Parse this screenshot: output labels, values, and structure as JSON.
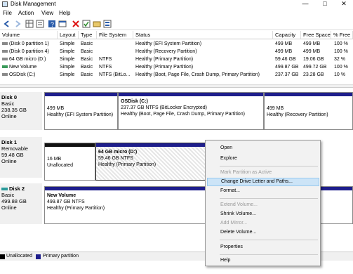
{
  "window": {
    "title": "Disk Management",
    "accent": "#1e1e8c",
    "controls": [
      "minimize",
      "maximize",
      "close"
    ]
  },
  "menu": [
    "File",
    "Action",
    "View",
    "Help"
  ],
  "toolbar": [
    "back-icon",
    "forward-icon",
    "grid-icon",
    "list-icon",
    "help-icon",
    "console-icon",
    "delete-icon",
    "check-icon",
    "open-icon",
    "properties-icon"
  ],
  "volume_list": {
    "columns": [
      "Volume",
      "Layout",
      "Type",
      "File System",
      "Status",
      "Capacity",
      "Free Space",
      "% Free"
    ],
    "rows": [
      {
        "volume": "(Disk 0 partition 1)",
        "layout": "Simple",
        "type": "Basic",
        "fs": "",
        "status": "Healthy (EFI System Partition)",
        "capacity": "499 MB",
        "free": "499 MB",
        "pct": "100 %",
        "icon": "gray"
      },
      {
        "volume": "(Disk 0 partition 4)",
        "layout": "Simple",
        "type": "Basic",
        "fs": "",
        "status": "Healthy (Recovery Partition)",
        "capacity": "499 MB",
        "free": "499 MB",
        "pct": "100 %",
        "icon": "gray"
      },
      {
        "volume": "64 GB micro (D:)",
        "layout": "Simple",
        "type": "Basic",
        "fs": "NTFS",
        "status": "Healthy (Primary Partition)",
        "capacity": "59.46 GB",
        "free": "19.06 GB",
        "pct": "32 %",
        "icon": "gray"
      },
      {
        "volume": "New Volume",
        "layout": "Simple",
        "type": "Basic",
        "fs": "NTFS",
        "status": "Healthy (Primary Partition)",
        "capacity": "499.87 GB",
        "free": "499.72 GB",
        "pct": "100 %",
        "icon": "green"
      },
      {
        "volume": "OSDisk (C:)",
        "layout": "Simple",
        "type": "Basic",
        "fs": "NTFS (BitLo...",
        "status": "Healthy (Boot, Page File, Crash Dump, Primary Partition)",
        "capacity": "237.37 GB",
        "free": "23.28 GB",
        "pct": "10 %",
        "icon": "gray"
      }
    ]
  },
  "disks": [
    {
      "name": "Disk 0",
      "type": "Basic",
      "size": "238.35 GB",
      "state": "Online",
      "partitions": [
        {
          "title": "",
          "line1": "499 MB",
          "line2": "Healthy (EFI System Partition)"
        },
        {
          "title": "OSDisk  (C:)",
          "line1": "237.37 GB NTFS (BitLocker Encrypted)",
          "line2": "Healthy (Boot, Page File, Crash Dump, Primary Partition)"
        },
        {
          "title": "",
          "line1": "499 MB",
          "line2": "Healthy (Recovery Partition)"
        }
      ]
    },
    {
      "name": "Disk 1",
      "type": "Removable",
      "size": "59.48 GB",
      "state": "Online",
      "partitions": [
        {
          "title": "",
          "line1": "16 MB",
          "line2": "Unallocated"
        },
        {
          "title": "64 GB micro  (D:)",
          "line1": "59.46 GB NTFS",
          "line2": "Healthy (Primary Partition)"
        }
      ]
    },
    {
      "name": "Disk 2",
      "type": "Basic",
      "size": "499.88 GB",
      "state": "Online",
      "partitions": [
        {
          "title": "New Volume",
          "line1": "499.87 GB NTFS",
          "line2": "Healthy (Primary Partition)"
        }
      ]
    }
  ],
  "legend": [
    {
      "label": "Unallocated",
      "color": "#000000"
    },
    {
      "label": "Primary partition",
      "color": "#1e1e8c"
    }
  ],
  "context_menu": {
    "highlight": "#cce4f7",
    "items": [
      {
        "label": "Open",
        "enabled": true
      },
      {
        "label": "Explore",
        "enabled": true
      },
      {
        "label": "Mark Partition as Active",
        "enabled": false
      },
      {
        "label": "Change Drive Letter and Paths...",
        "enabled": true,
        "highlighted": true
      },
      {
        "label": "Format...",
        "enabled": true
      },
      {
        "label": "Extend Volume...",
        "enabled": false
      },
      {
        "label": "Shrink Volume...",
        "enabled": true
      },
      {
        "label": "Add Mirror...",
        "enabled": false
      },
      {
        "label": "Delete Volume...",
        "enabled": true
      },
      {
        "label": "Properties",
        "enabled": true
      },
      {
        "label": "Help",
        "enabled": true
      }
    ]
  }
}
